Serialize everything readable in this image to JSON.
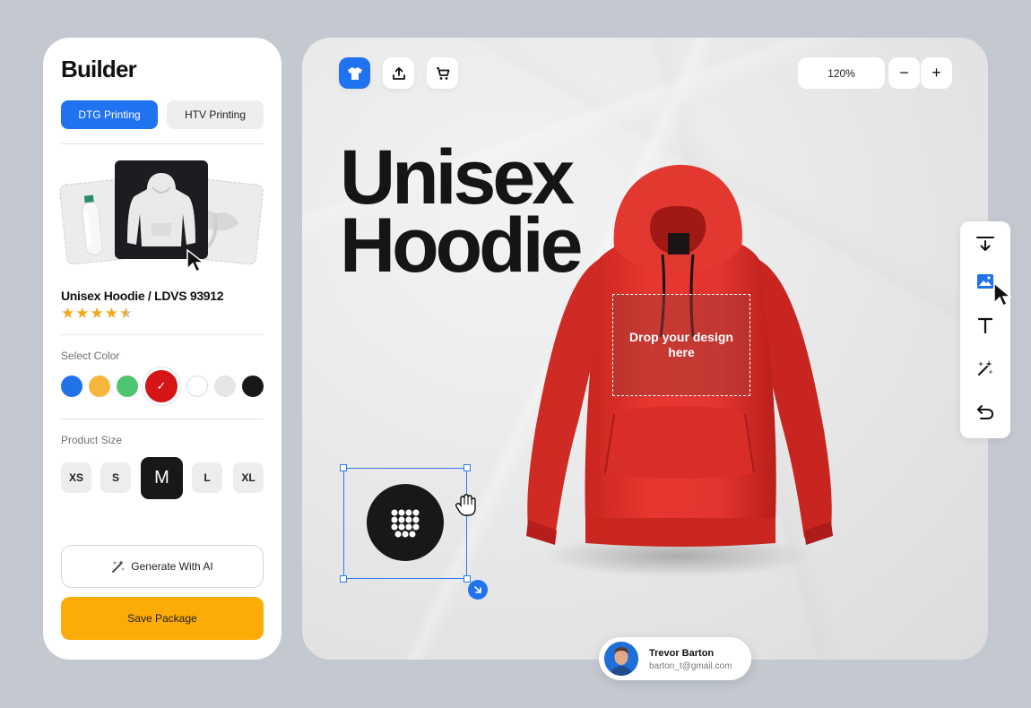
{
  "builder": {
    "title": "Builder",
    "tabs": [
      {
        "label": "DTG Printing",
        "active": true
      },
      {
        "label": "HTV Printing",
        "active": false
      }
    ],
    "product": {
      "name": "Unisex Hoodie / LDVS 93912",
      "rating": 4.5,
      "rating_max": 5,
      "star_glyph": "★"
    },
    "color_section_label": "Select Color",
    "colors": [
      "#2172e9",
      "#f6b53c",
      "#4ec46f",
      "#d61517",
      "#ffffff",
      "#e5e5e7",
      "#17181a"
    ],
    "selected_color": "#d61517",
    "check_icon": "✓",
    "size_section_label": "Product Size",
    "sizes": [
      "XS",
      "S",
      "M",
      "L",
      "XL"
    ],
    "selected_size": "M",
    "generate_label": "Generate With AI",
    "save_label": "Save Package"
  },
  "canvas": {
    "tools": [
      "tshirt-icon",
      "upload-icon",
      "cart-icon"
    ],
    "zoom": "120%",
    "zoom_out_glyph": "−",
    "zoom_in_glyph": "+",
    "headline_line1": "Unisex",
    "headline_line2": "Hoodie",
    "hoodie_color": "#e3342f",
    "drop_zone_text": "Drop your design here",
    "side_tools": [
      "download-icon",
      "image-icon",
      "text-icon",
      "magic-wand-icon",
      "undo-icon"
    ],
    "accent": "#1f73f0"
  },
  "user": {
    "name": "Trevor Barton",
    "email": "barton_t@gmail.com"
  }
}
